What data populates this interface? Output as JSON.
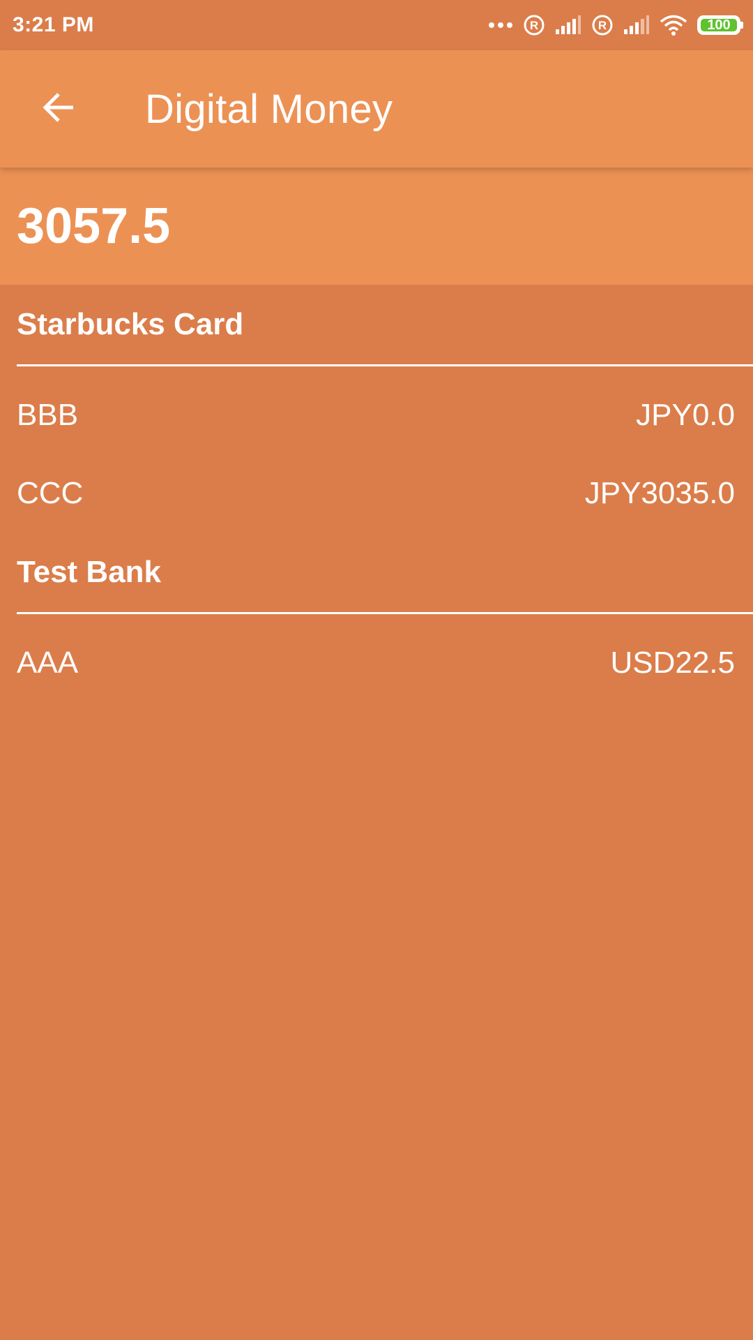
{
  "status_bar": {
    "time": "3:21 PM",
    "battery_level": "100",
    "icons": [
      "more-dots-icon",
      "roaming-r-icon",
      "signal-icon",
      "roaming-r-icon",
      "signal-icon",
      "wifi-icon",
      "battery-icon"
    ],
    "battery_color": "#5fc22e"
  },
  "app_bar": {
    "title": "Digital Money",
    "back_icon": "arrow-left-icon",
    "background": "#ec9154"
  },
  "total": {
    "amount": "3057.5"
  },
  "groups": [
    {
      "name": "Starbucks Card",
      "items": [
        {
          "name": "BBB",
          "balance": "JPY0.0"
        },
        {
          "name": "CCC",
          "balance": "JPY3035.0"
        }
      ]
    },
    {
      "name": "Test Bank",
      "items": [
        {
          "name": "AAA",
          "balance": "USD22.5"
        }
      ]
    }
  ],
  "colors": {
    "page_background": "#db7d4a",
    "accent": "#ec9154",
    "text": "#ffffff"
  }
}
